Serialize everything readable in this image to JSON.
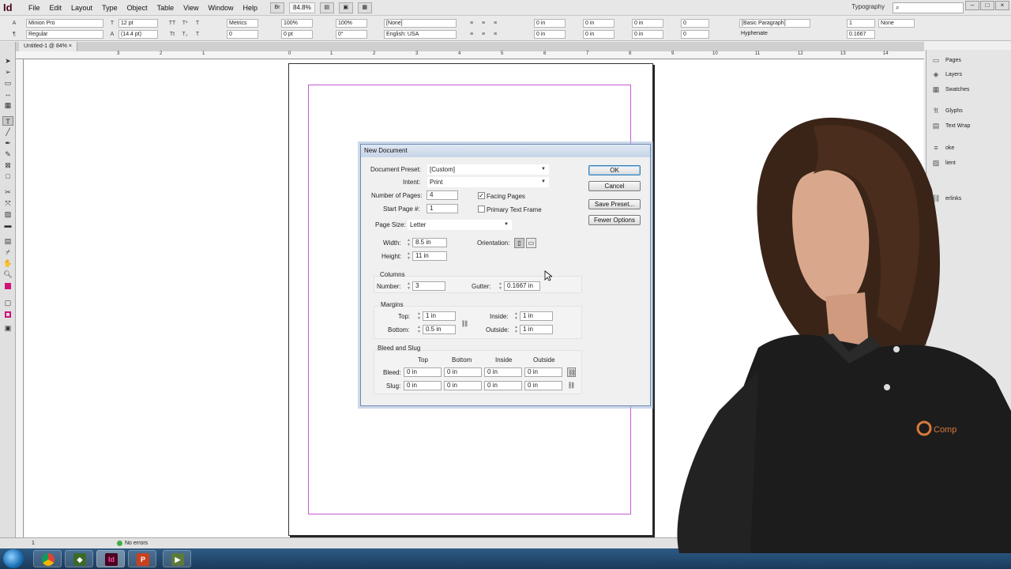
{
  "menubar": {
    "logo": "Id",
    "items": [
      "File",
      "Edit",
      "Layout",
      "Type",
      "Object",
      "Table",
      "View",
      "Window",
      "Help"
    ],
    "br_label": "Br",
    "zoom": "84.8%",
    "workspace": "Typography",
    "window_buttons": [
      "–",
      "□",
      "×"
    ]
  },
  "control": {
    "font_family": "Minion Pro",
    "font_style": "Regular",
    "font_size": "12 pt",
    "leading": "(14.4 pt)",
    "kerning": "Metrics",
    "tracking": "0",
    "vscale": "100%",
    "baseline": "0 pt",
    "hscale": "100%",
    "skew": "0°",
    "char_style": "[None]",
    "language": "English: USA",
    "indent_fields": [
      "0 in",
      "0 in",
      "0 in",
      "0 in",
      "0 in",
      "0 in",
      "0",
      "0"
    ],
    "para_style": "[Basic Paragraph]",
    "hyphenate": "Hyphenate",
    "columns": "1",
    "gutter": "0.1667",
    "none": "None"
  },
  "document": {
    "tab": "Untitled-1 @ 84%",
    "ruler_ticks": [
      "3",
      "2",
      "1",
      "0",
      "1",
      "2",
      "3",
      "4",
      "5",
      "6",
      "7",
      "8",
      "9",
      "10",
      "11",
      "12",
      "13",
      "14"
    ]
  },
  "panels": {
    "items": [
      "Pages",
      "Layers",
      "Swatches",
      "Glyphs",
      "Text Wrap",
      "oke",
      "lient",
      "erlinks"
    ]
  },
  "status": {
    "page": "1",
    "errors": "No errors"
  },
  "dialog": {
    "title": "New Document",
    "preset_label": "Document Preset:",
    "preset_value": "[Custom]",
    "intent_label": "Intent:",
    "intent_value": "Print",
    "num_pages_label": "Number of Pages:",
    "num_pages_value": "4",
    "start_page_label": "Start Page #:",
    "start_page_value": "1",
    "facing_pages_label": "Facing Pages",
    "facing_pages_checked": true,
    "primary_text_frame_label": "Primary Text Frame",
    "primary_text_frame_checked": false,
    "page_size_label": "Page Size:",
    "page_size_value": "Letter",
    "width_label": "Width:",
    "width_value": "8.5 in",
    "height_label": "Height:",
    "height_value": "11 in",
    "orientation_label": "Orientation:",
    "columns_section": "Columns",
    "col_number_label": "Number:",
    "col_number_value": "3",
    "gutter_label": "Gutter:",
    "gutter_value": "0.1667 in",
    "margins_section": "Margins",
    "top_label": "Top:",
    "top_value": "1 in",
    "bottom_label": "Bottom:",
    "bottom_value": "0.5 in",
    "inside_label": "Inside:",
    "inside_value": "1 in",
    "outside_label": "Outside:",
    "outside_value": "1 in",
    "bleed_section": "Bleed and Slug",
    "col_headers": [
      "Top",
      "Bottom",
      "Inside",
      "Outside"
    ],
    "bleed_label": "Bleed:",
    "bleed_values": [
      "0 in",
      "0 in",
      "0 in",
      "0 in"
    ],
    "slug_label": "Slug:",
    "slug_values": [
      "0 in",
      "0 in",
      "0 in",
      "0 in"
    ],
    "ok_label": "OK",
    "cancel_label": "Cancel",
    "save_preset_label": "Save Preset...",
    "fewer_options_label": "Fewer Options"
  },
  "presenter": {
    "shirt_text": "Comp"
  },
  "colors": {
    "margin_guide": "#c45bd0",
    "indesign_brand": "#49021f",
    "shirt": "#1c1c1c"
  }
}
